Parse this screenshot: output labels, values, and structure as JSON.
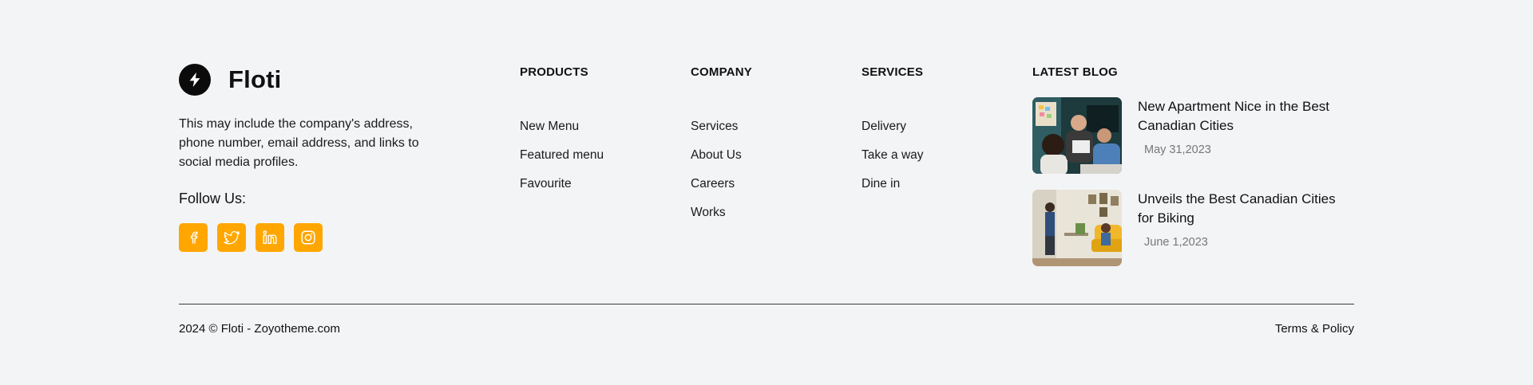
{
  "brand": {
    "name": "Floti",
    "description": "This may include the company's address, phone number, email address, and links to social media profiles.",
    "logo_icon": "lightning-bolt-icon"
  },
  "follow": {
    "title": "Follow Us:",
    "socials": [
      {
        "name": "facebook",
        "icon": "facebook-icon"
      },
      {
        "name": "twitter",
        "icon": "twitter-icon"
      },
      {
        "name": "linkedin",
        "icon": "linkedin-icon"
      },
      {
        "name": "instagram",
        "icon": "instagram-icon"
      }
    ],
    "accent_color": "#ffa600"
  },
  "columns": {
    "products": {
      "title": "PRODUCTS",
      "items": [
        "New Menu",
        "Featured menu",
        "Favourite"
      ]
    },
    "company": {
      "title": "COMPANY",
      "items": [
        "Services",
        "About Us",
        "Careers",
        "Works"
      ]
    },
    "services": {
      "title": "SERVICES",
      "items": [
        "Delivery",
        "Take a way",
        "Dine in"
      ]
    }
  },
  "blog": {
    "title": "LATEST BLOG",
    "posts": [
      {
        "title": "New Apartment Nice in the Best Canadian Cities",
        "date": "May 31,2023"
      },
      {
        "title": "Unveils the Best Canadian Cities for Biking",
        "date": "June 1,2023"
      }
    ]
  },
  "bottom": {
    "copyright": "2024 © Floti - Zoyotheme.com",
    "terms": "Terms & Policy"
  }
}
